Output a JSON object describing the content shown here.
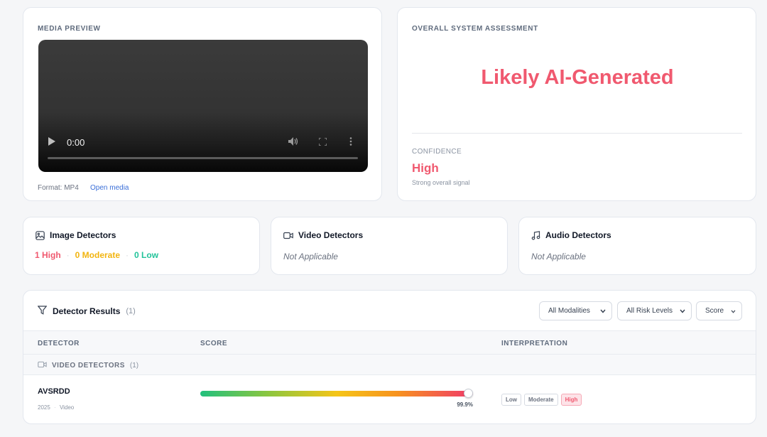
{
  "media": {
    "section_label": "MEDIA PREVIEW",
    "current_time": "0:00",
    "format": "Format: MP4",
    "open_link": "Open media"
  },
  "assessment": {
    "section_label": "OVERALL SYSTEM ASSESSMENT",
    "verdict": "Likely AI-Generated",
    "confidence_label": "CONFIDENCE",
    "confidence_value": "High",
    "confidence_note": "Strong overall signal",
    "accent_color": "#f0596f"
  },
  "summary": {
    "image": {
      "title": "Image Detectors",
      "high": "1 High",
      "moderate": "0 Moderate",
      "low": "0 Low",
      "separator": "·"
    },
    "video": {
      "title": "Video Detectors",
      "status": "Not Applicable"
    },
    "audio": {
      "title": "Audio Detectors",
      "status": "Not Applicable"
    }
  },
  "results": {
    "title": "Detector Results",
    "count": "(1)",
    "filters": {
      "modality": "All Modalities",
      "risk": "All Risk Levels",
      "sort": "Score"
    },
    "columns": {
      "detector": "DETECTOR",
      "score": "SCORE",
      "interpretation": "INTERPRETATION"
    },
    "groups": [
      {
        "label": "VIDEO DETECTORS",
        "count": "(1)",
        "rows": [
          {
            "name": "AVSRDD",
            "year": "2025",
            "sep": "·",
            "modality": "Video",
            "score_pct": 99.9,
            "score_text": "99.9%",
            "levels": [
              "Low",
              "Moderate",
              "High"
            ],
            "active_level": "High"
          }
        ]
      }
    ]
  },
  "icons": {
    "image": "image-icon",
    "video": "video-camera-icon",
    "audio": "music-note-icon",
    "filter": "filter-funnel-icon",
    "play": "play-icon",
    "volume": "volume-icon",
    "fullscreen": "fullscreen-icon",
    "more": "more-vertical-icon",
    "chevron": "chevron-down-icon"
  }
}
